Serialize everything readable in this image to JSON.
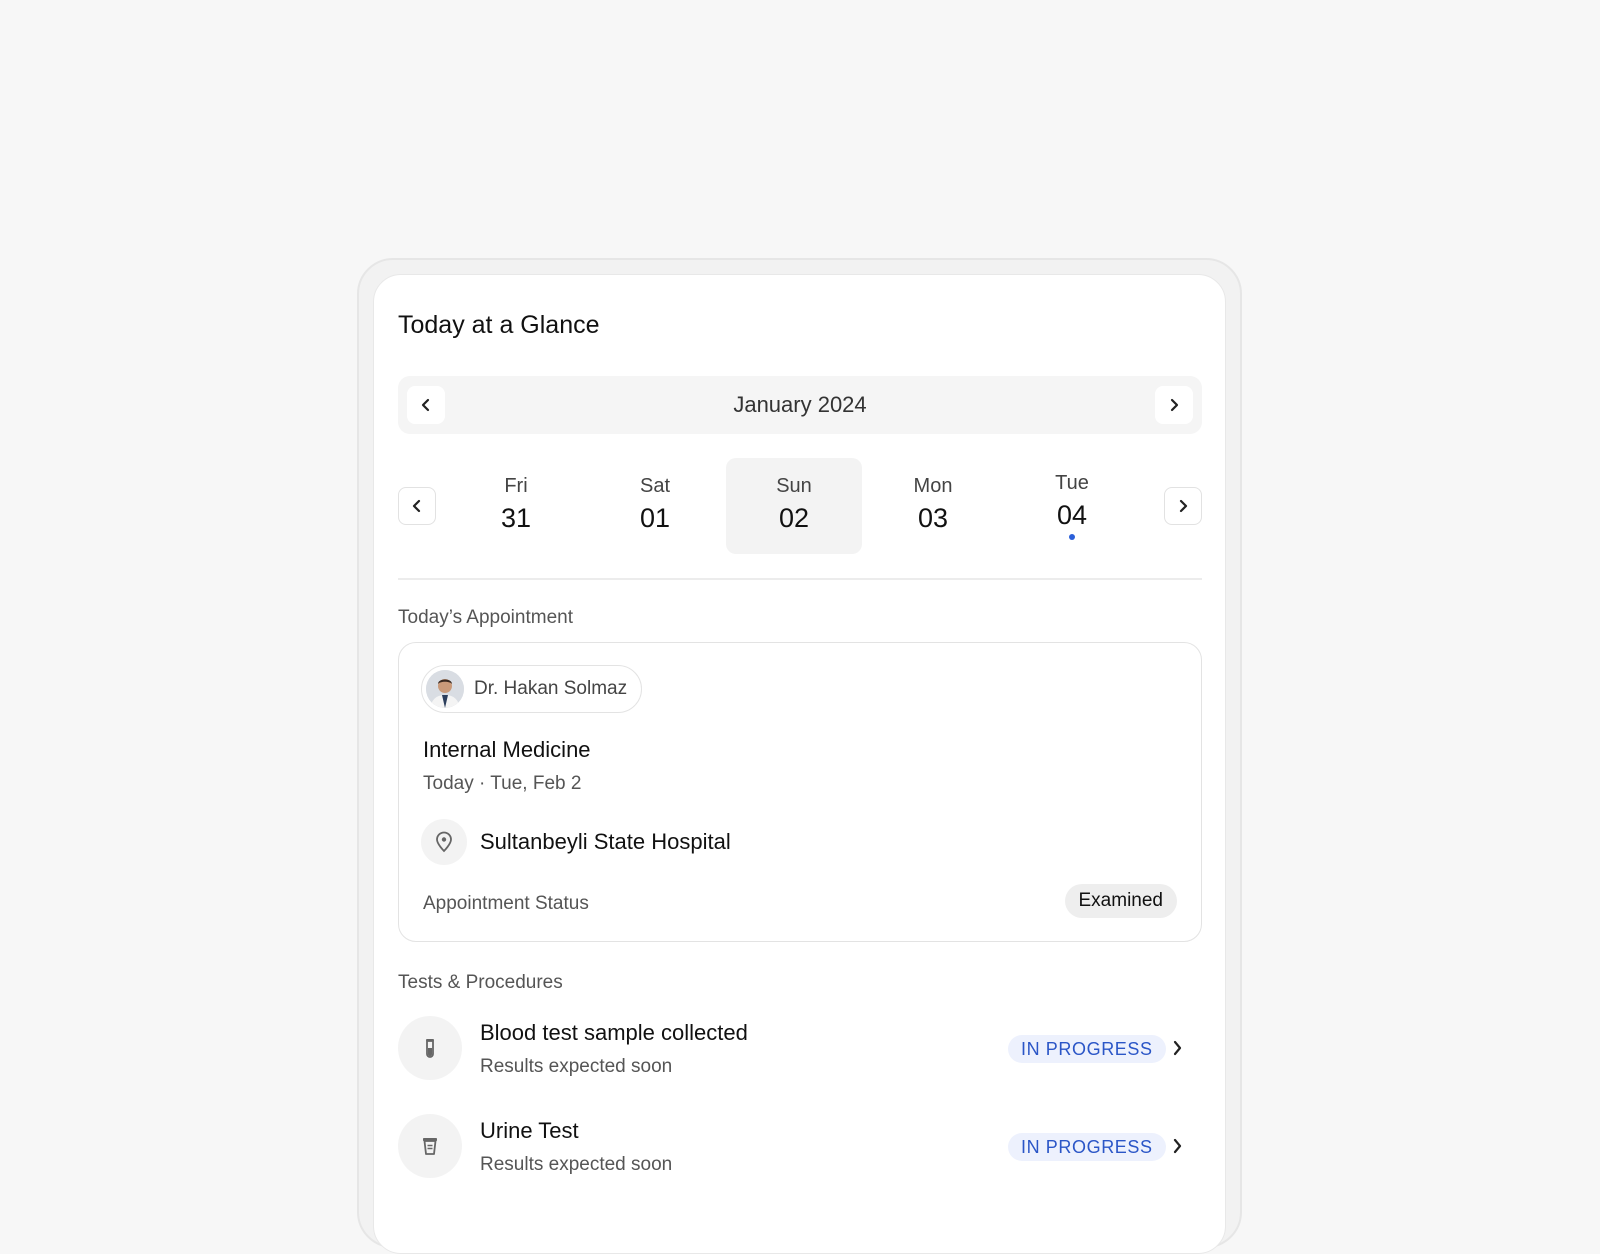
{
  "card": {
    "title": "Today at a Glance"
  },
  "calendar": {
    "month_label": "January 2024",
    "days": [
      {
        "name": "Fri",
        "num": "31"
      },
      {
        "name": "Sat",
        "num": "01"
      },
      {
        "name": "Sun",
        "num": "02",
        "selected": true
      },
      {
        "name": "Mon",
        "num": "03"
      },
      {
        "name": "Tue",
        "num": "04",
        "today_marker": true
      }
    ]
  },
  "appointment": {
    "section_label": "Today’s Appointment",
    "doctor_name": "Dr. Hakan Solmaz",
    "specialty": "Internal Medicine",
    "date_text": "Today · Tue, Feb 2",
    "location": "Sultanbeyli State Hospital",
    "status_label": "Appointment Status",
    "status_value": "Examined"
  },
  "procedures": {
    "section_label": "Tests & Procedures",
    "items": [
      {
        "title": "Blood test sample collected",
        "subtitle": "Results expected soon",
        "status": "IN PROGRESS",
        "icon": "test-tube-icon"
      },
      {
        "title": "Urine Test",
        "subtitle": "Results expected soon",
        "status": "IN PROGRESS",
        "icon": "specimen-cup-icon"
      }
    ]
  },
  "colors": {
    "accent": "#2b5fd9",
    "badge_progress_bg": "#edf1fd",
    "badge_progress_text": "#2b56c7",
    "page_bg": "#f7f7f7"
  }
}
